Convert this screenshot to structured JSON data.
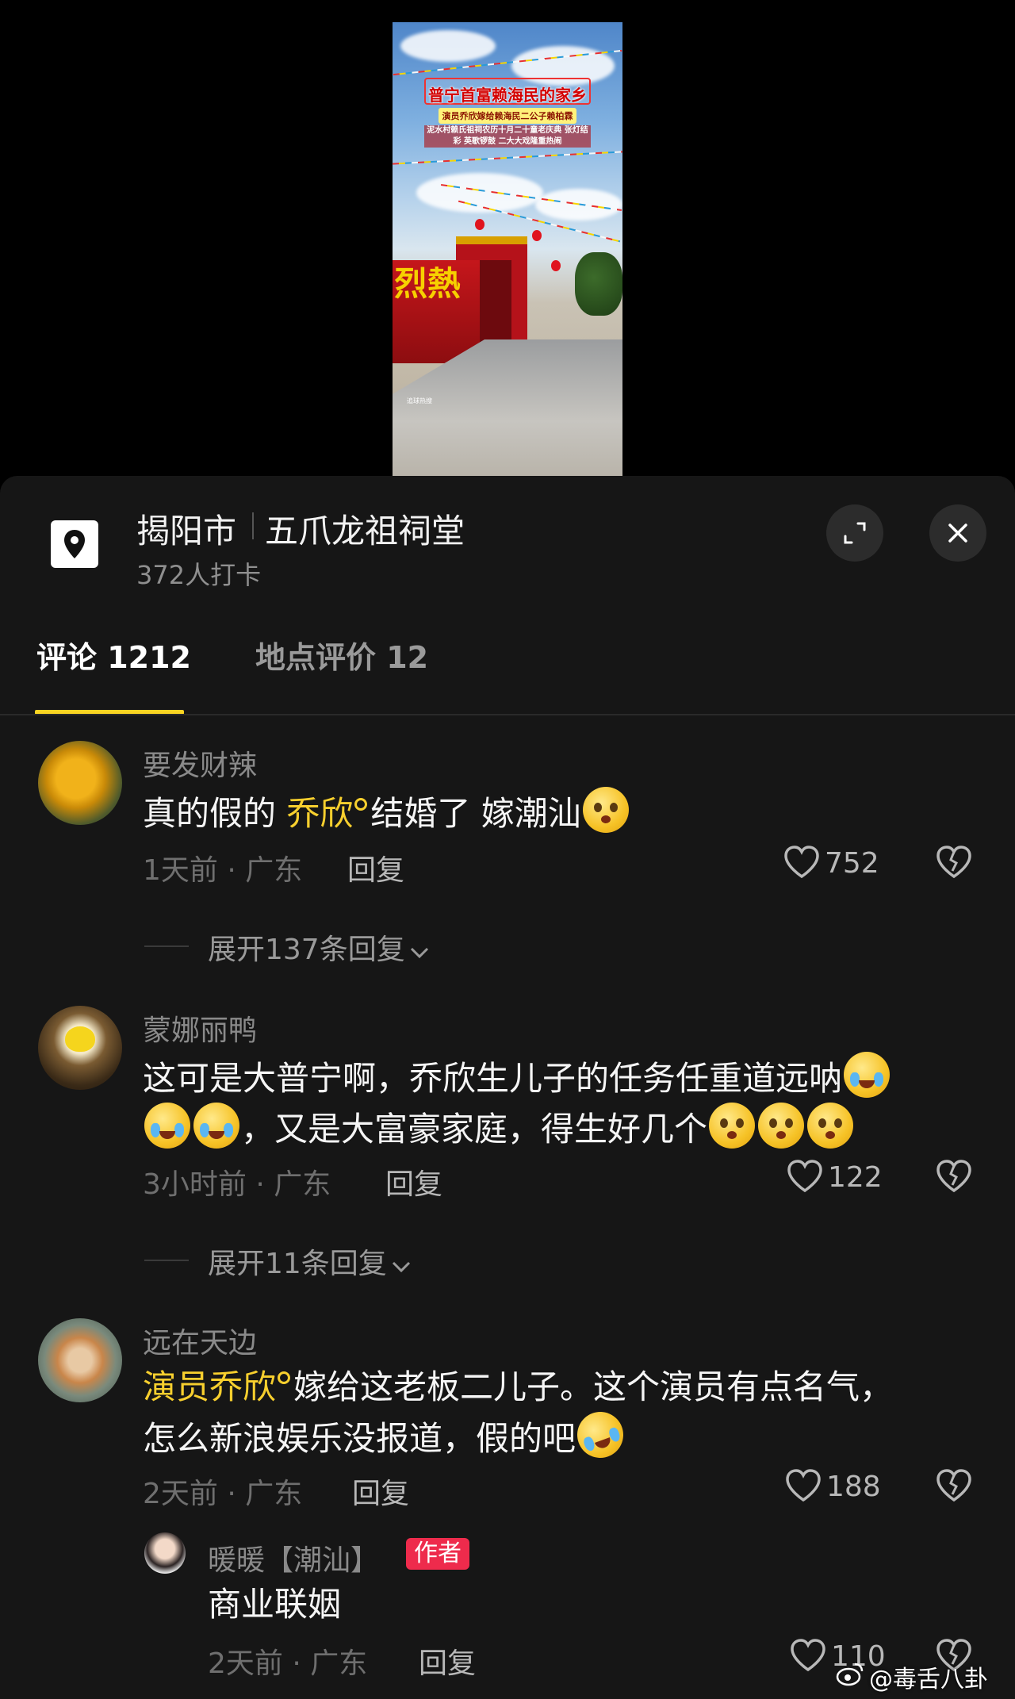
{
  "video": {
    "caption_title": "普宁首富赖海民的家乡",
    "caption_subtitle": "演员乔欣嫁给赖海民二公子赖柏霖",
    "caption_detail": "泥水村赖氏祖祠农历十月二十童老庆典 张灯结彩 英歌锣鼓 二大大戏隆重热闹",
    "wall_text": "烈熱",
    "watermark": "追球热搜"
  },
  "location": {
    "city": "揭阳市",
    "name": "五爪龙祖祠堂",
    "checkins": "372人打卡",
    "icon": "location-pin-icon"
  },
  "tabs": [
    {
      "label": "评论 1212",
      "active": true
    },
    {
      "label": "地点评价 12",
      "active": false
    }
  ],
  "colors": {
    "accent": "#f9d422",
    "mention": "#f7cf2e",
    "author_badge": "#ee2b4c",
    "panel_bg": "#161616"
  },
  "comments": [
    {
      "username": "要发财辣",
      "text_before": "真的假的 ",
      "mention": "乔欣",
      "text_after": "结婚了 嫁潮汕",
      "emojis": [
        "pleading-face"
      ],
      "time_location": "1天前 · 广东",
      "reply_label": "回复",
      "likes": "752",
      "expand_label": "展开137条回复"
    },
    {
      "username": "蒙娜丽鸭",
      "line1": "这可是大普宁啊，乔欣生儿子的任务任重道远呐",
      "line2": "，又是大富豪家庭，得生好几个",
      "emojis": [
        "loudly-crying-face",
        "loudly-crying-face",
        "loudly-crying-face",
        "pleading-face",
        "pleading-face",
        "pleading-face"
      ],
      "time_location": "3小时前 · 广东",
      "reply_label": "回复",
      "likes": "122",
      "expand_label": "展开11条回复"
    },
    {
      "username": "远在天边",
      "mention": "演员乔欣",
      "line1_after": "嫁给这老板二儿子。这个演员有点名气，",
      "line2": "怎么新浪娱乐没报道，假的吧",
      "emojis": [
        "rolling-laughing-face"
      ],
      "time_location": "2天前 · 广东",
      "reply_label": "回复",
      "likes": "188"
    }
  ],
  "reply": {
    "username": "暖暖【潮汕】",
    "badge": "作者",
    "text": "商业联姻",
    "time_location": "2天前 · 广东",
    "reply_label": "回复",
    "likes": "110"
  },
  "watermark": "@毒舌八卦"
}
